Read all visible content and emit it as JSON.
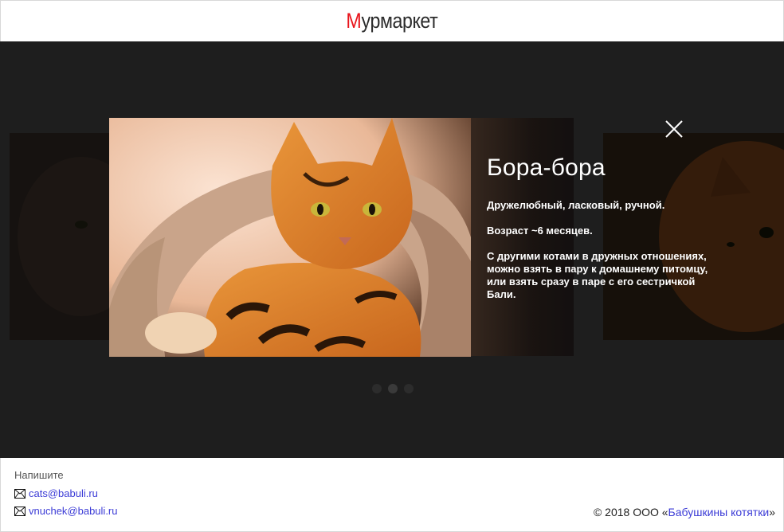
{
  "header": {
    "logo_first": "М",
    "logo_rest": "урмаркет"
  },
  "modal": {
    "title": "Бора-бора",
    "description": [
      "Дружелюбный, ласковый, ручной.",
      "Возраст ~6 месяцев.",
      "С другими котами в дружных отношениях, можно взять в пару к домашнему питомцу, или взять сразу в паре с его сестричкой Бали."
    ],
    "close_icon": "close-icon"
  },
  "carousel": {
    "dots": 3,
    "active_index": 1
  },
  "footer": {
    "contact_title": "Напишите",
    "emails": [
      "cats@babuli.ru",
      "vnuchek@babuli.ru"
    ],
    "copyright_prefix": "© 2018 ООО «",
    "copyright_link": "Бабушкины котятки",
    "copyright_suffix": "»"
  },
  "colors": {
    "accent": "#e8141b",
    "link": "#3b3bd6",
    "overlay": "#1e1e1e"
  }
}
